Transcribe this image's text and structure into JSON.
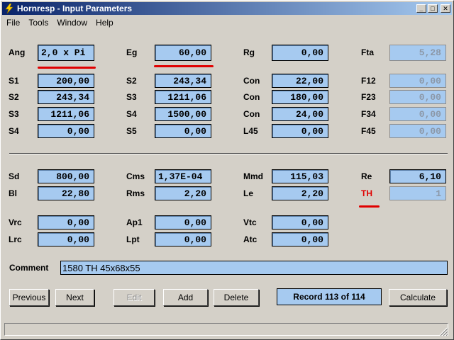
{
  "window": {
    "title": "Hornresp - Input Parameters",
    "title_icon": "lightning-icon"
  },
  "title_buttons": {
    "minimize": "_",
    "maximize": "□",
    "close": "✕"
  },
  "menu": [
    "File",
    "Tools",
    "Window",
    "Help"
  ],
  "colors": {
    "field_bg": "#a6caf0",
    "accent_red": "#e00000",
    "title_start": "#0a246a",
    "title_end": "#a6caf0"
  },
  "rows": {
    "r1": {
      "c1": {
        "label": "Ang",
        "value": "2,0 x Pi"
      },
      "c2": {
        "label": "Eg",
        "value": "60,00"
      },
      "c3": {
        "label": "Rg",
        "value": "0,00"
      },
      "c4": {
        "label": "Fta",
        "value": "5,28"
      }
    },
    "r2": {
      "c1": {
        "label": "S1",
        "value": "200,00"
      },
      "c2": {
        "label": "S2",
        "value": "243,34"
      },
      "c3": {
        "label": "Con",
        "value": "22,00"
      },
      "c4": {
        "label": "F12",
        "value": "0,00"
      }
    },
    "r3": {
      "c1": {
        "label": "S2",
        "value": "243,34"
      },
      "c2": {
        "label": "S3",
        "value": "1211,06"
      },
      "c3": {
        "label": "Con",
        "value": "180,00"
      },
      "c4": {
        "label": "F23",
        "value": "0,00"
      }
    },
    "r4": {
      "c1": {
        "label": "S3",
        "value": "1211,06"
      },
      "c2": {
        "label": "S4",
        "value": "1500,00"
      },
      "c3": {
        "label": "Con",
        "value": "24,00"
      },
      "c4": {
        "label": "F34",
        "value": "0,00"
      }
    },
    "r5": {
      "c1": {
        "label": "S4",
        "value": "0,00"
      },
      "c2": {
        "label": "S5",
        "value": "0,00"
      },
      "c3": {
        "label": "L45",
        "value": "0,00"
      },
      "c4": {
        "label": "F45",
        "value": "0,00"
      }
    },
    "r6": {
      "c1": {
        "label": "Sd",
        "value": "800,00"
      },
      "c2": {
        "label": "Cms",
        "value": "1,37E-04"
      },
      "c3": {
        "label": "Mmd",
        "value": "115,03"
      },
      "c4": {
        "label": "Re",
        "value": "6,10"
      }
    },
    "r7": {
      "c1": {
        "label": "Bl",
        "value": "22,80"
      },
      "c2": {
        "label": "Rms",
        "value": "2,20"
      },
      "c3": {
        "label": "Le",
        "value": "2,20"
      },
      "c4": {
        "label": "TH",
        "value": "1"
      }
    },
    "r8": {
      "c1": {
        "label": "Vrc",
        "value": "0,00"
      },
      "c2": {
        "label": "Ap1",
        "value": "0,00"
      },
      "c3": {
        "label": "Vtc",
        "value": "0,00"
      }
    },
    "r9": {
      "c1": {
        "label": "Lrc",
        "value": "0,00"
      },
      "c2": {
        "label": "Lpt",
        "value": "0,00"
      },
      "c3": {
        "label": "Atc",
        "value": "0,00"
      }
    }
  },
  "comment": {
    "label": "Comment",
    "value": "1580  TH 45x68x55"
  },
  "buttons": {
    "previous": "Previous",
    "next": "Next",
    "edit": "Edit",
    "add": "Add",
    "delete": "Delete",
    "calculate": "Calculate"
  },
  "record_status": "Record 113 of 114",
  "status_text": ""
}
